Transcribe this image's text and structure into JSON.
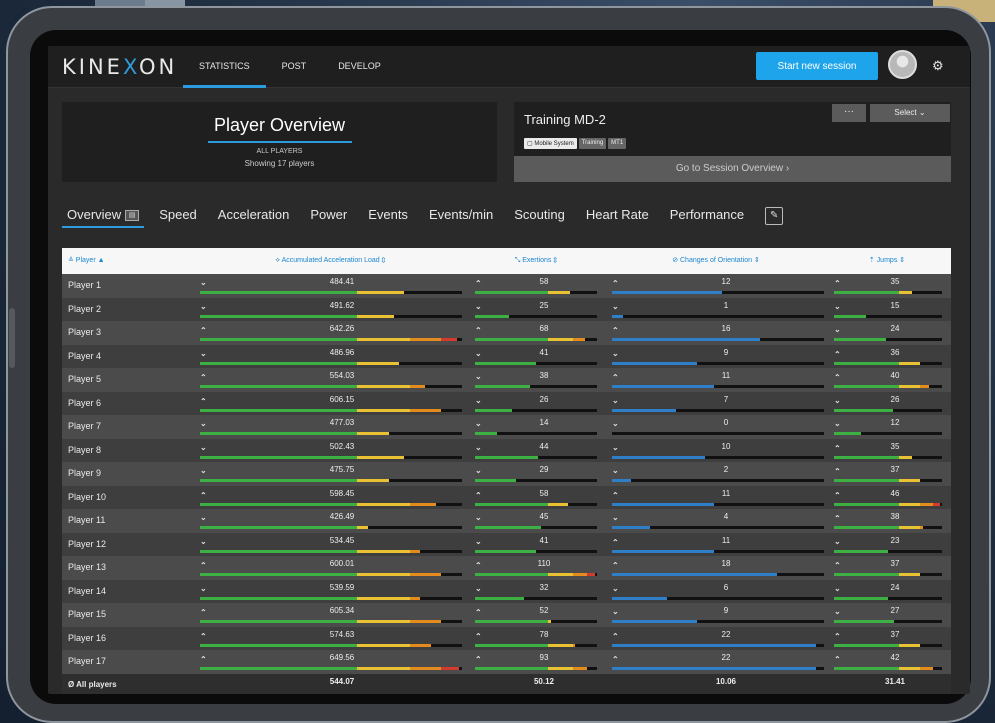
{
  "app": {
    "logo_pre": "KINE",
    "logo_x": "X",
    "logo_post": "ON"
  },
  "nav": [
    {
      "label": "STATISTICS",
      "active": true
    },
    {
      "label": "POST",
      "active": false
    },
    {
      "label": "DEVELOP",
      "active": false
    }
  ],
  "header": {
    "start_session": "Start new session"
  },
  "overview": {
    "title": "Player Overview",
    "subtitle": "ALL PLAYERS",
    "count": "Showing 17 players"
  },
  "session": {
    "title": "Training MD-2",
    "more": "···",
    "select": "Select ⌄",
    "tags": [
      "Mobile System",
      "Training",
      "MT1"
    ],
    "goto": "Go to Session Overview  ›"
  },
  "tabs": [
    {
      "label": "Overview",
      "active": true
    },
    {
      "label": "Speed"
    },
    {
      "label": "Acceleration"
    },
    {
      "label": "Power"
    },
    {
      "label": "Events"
    },
    {
      "label": "Events/min"
    },
    {
      "label": "Scouting"
    },
    {
      "label": "Heart Rate"
    },
    {
      "label": "Performance"
    }
  ],
  "columns": [
    "≗ Player  ▲",
    "⟡ Accumulated Acceleration Load  ⇕",
    "⤡ Exertions  ⇕",
    "⊘ Changes of Orientation  ⇕",
    "⇡ Jumps  ⇕"
  ],
  "colors": {
    "blue": "#2d9be0",
    "green": "#3cb043",
    "yellow": "#e8c233",
    "orange": "#e38b1c",
    "red": "#d33b2c",
    "orient": "#2e7fc7"
  },
  "rows": [
    {
      "name": "Player 1",
      "aal": "484.41",
      "aal_dir": "down",
      "ex": "58",
      "ex_dir": "up",
      "co": "12",
      "co_dir": "up",
      "j": "35",
      "j_dir": "up",
      "aal_frac": 0.78,
      "ex_frac": 0.78,
      "co_frac": 0.52,
      "j_frac": 0.72
    },
    {
      "name": "Player 2",
      "aal": "491.62",
      "aal_dir": "down",
      "ex": "25",
      "ex_dir": "down",
      "co": "1",
      "co_dir": "down",
      "j": "15",
      "j_dir": "down",
      "aal_frac": 0.74,
      "ex_frac": 0.28,
      "co_frac": 0.05,
      "j_frac": 0.3
    },
    {
      "name": "Player 3",
      "aal": "642.26",
      "aal_dir": "up",
      "ex": "68",
      "ex_dir": "up",
      "co": "16",
      "co_dir": "up",
      "j": "24",
      "j_dir": "down",
      "aal_frac": 0.98,
      "ex_frac": 0.9,
      "co_frac": 0.7,
      "j_frac": 0.48
    },
    {
      "name": "Player 4",
      "aal": "486.96",
      "aal_dir": "down",
      "ex": "41",
      "ex_dir": "down",
      "co": "9",
      "co_dir": "down",
      "j": "36",
      "j_dir": "up",
      "aal_frac": 0.76,
      "ex_frac": 0.5,
      "co_frac": 0.4,
      "j_frac": 0.8
    },
    {
      "name": "Player 5",
      "aal": "554.03",
      "aal_dir": "up",
      "ex": "38",
      "ex_dir": "down",
      "co": "11",
      "co_dir": "up",
      "j": "40",
      "j_dir": "up",
      "aal_frac": 0.86,
      "ex_frac": 0.45,
      "co_frac": 0.48,
      "j_frac": 0.88
    },
    {
      "name": "Player 6",
      "aal": "606.15",
      "aal_dir": "up",
      "ex": "26",
      "ex_dir": "down",
      "co": "7",
      "co_dir": "down",
      "j": "26",
      "j_dir": "down",
      "aal_frac": 0.92,
      "ex_frac": 0.3,
      "co_frac": 0.3,
      "j_frac": 0.55
    },
    {
      "name": "Player 7",
      "aal": "477.03",
      "aal_dir": "down",
      "ex": "14",
      "ex_dir": "down",
      "co": "0",
      "co_dir": "down",
      "j": "12",
      "j_dir": "down",
      "aal_frac": 0.72,
      "ex_frac": 0.18,
      "co_frac": 0.0,
      "j_frac": 0.25
    },
    {
      "name": "Player 8",
      "aal": "502.43",
      "aal_dir": "down",
      "ex": "44",
      "ex_dir": "down",
      "co": "10",
      "co_dir": "down",
      "j": "35",
      "j_dir": "up",
      "aal_frac": 0.78,
      "ex_frac": 0.52,
      "co_frac": 0.44,
      "j_frac": 0.72
    },
    {
      "name": "Player 9",
      "aal": "475.75",
      "aal_dir": "down",
      "ex": "29",
      "ex_dir": "down",
      "co": "2",
      "co_dir": "down",
      "j": "37",
      "j_dir": "up",
      "aal_frac": 0.72,
      "ex_frac": 0.34,
      "co_frac": 0.09,
      "j_frac": 0.8
    },
    {
      "name": "Player 10",
      "aal": "598.45",
      "aal_dir": "up",
      "ex": "58",
      "ex_dir": "up",
      "co": "11",
      "co_dir": "up",
      "j": "46",
      "j_dir": "up",
      "aal_frac": 0.9,
      "ex_frac": 0.76,
      "co_frac": 0.48,
      "j_frac": 0.98
    },
    {
      "name": "Player 11",
      "aal": "426.49",
      "aal_dir": "down",
      "ex": "45",
      "ex_dir": "down",
      "co": "4",
      "co_dir": "down",
      "j": "38",
      "j_dir": "up",
      "aal_frac": 0.64,
      "ex_frac": 0.54,
      "co_frac": 0.18,
      "j_frac": 0.82
    },
    {
      "name": "Player 12",
      "aal": "534.45",
      "aal_dir": "down",
      "ex": "41",
      "ex_dir": "down",
      "co": "11",
      "co_dir": "up",
      "j": "23",
      "j_dir": "down",
      "aal_frac": 0.84,
      "ex_frac": 0.5,
      "co_frac": 0.48,
      "j_frac": 0.5
    },
    {
      "name": "Player 13",
      "aal": "600.01",
      "aal_dir": "up",
      "ex": "110",
      "ex_dir": "up",
      "co": "18",
      "co_dir": "up",
      "j": "37",
      "j_dir": "up",
      "aal_frac": 0.92,
      "ex_frac": 0.98,
      "co_frac": 0.78,
      "j_frac": 0.8
    },
    {
      "name": "Player 14",
      "aal": "539.59",
      "aal_dir": "down",
      "ex": "32",
      "ex_dir": "down",
      "co": "6",
      "co_dir": "down",
      "j": "24",
      "j_dir": "down",
      "aal_frac": 0.84,
      "ex_frac": 0.4,
      "co_frac": 0.26,
      "j_frac": 0.5
    },
    {
      "name": "Player 15",
      "aal": "605.34",
      "aal_dir": "up",
      "ex": "52",
      "ex_dir": "up",
      "co": "9",
      "co_dir": "down",
      "j": "27",
      "j_dir": "down",
      "aal_frac": 0.92,
      "ex_frac": 0.62,
      "co_frac": 0.4,
      "j_frac": 0.56
    },
    {
      "name": "Player 16",
      "aal": "574.63",
      "aal_dir": "up",
      "ex": "78",
      "ex_dir": "up",
      "co": "22",
      "co_dir": "up",
      "j": "37",
      "j_dir": "up",
      "aal_frac": 0.88,
      "ex_frac": 0.82,
      "co_frac": 0.96,
      "j_frac": 0.8
    },
    {
      "name": "Player 17",
      "aal": "649.56",
      "aal_dir": "up",
      "ex": "93",
      "ex_dir": "up",
      "co": "22",
      "co_dir": "up",
      "j": "42",
      "j_dir": "up",
      "aal_frac": 0.99,
      "ex_frac": 0.92,
      "co_frac": 0.96,
      "j_frac": 0.92
    }
  ],
  "average": {
    "name": "Ø   All players",
    "aal": "544.07",
    "ex": "50.12",
    "co": "10.06",
    "j": "31.41"
  }
}
